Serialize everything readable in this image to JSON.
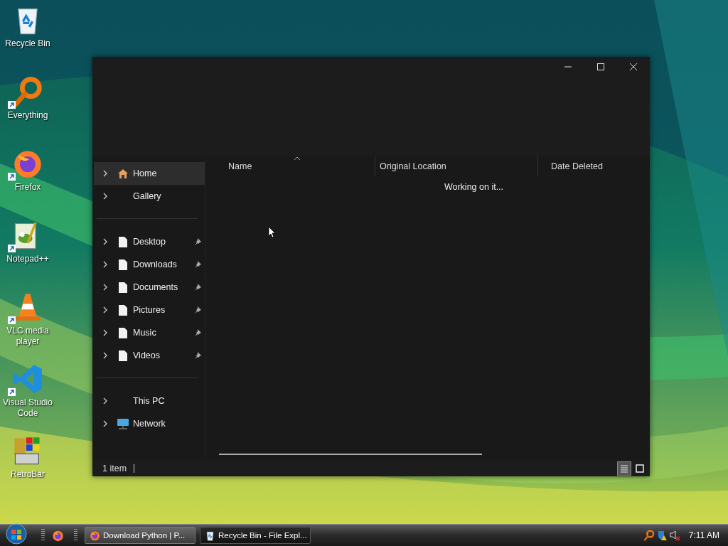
{
  "desktop_icons": [
    {
      "label": "Recycle Bin",
      "kind": "recycle",
      "shortcut": false
    },
    {
      "label": "Everything",
      "kind": "everything",
      "shortcut": true
    },
    {
      "label": "Firefox",
      "kind": "firefox",
      "shortcut": true
    },
    {
      "label": "Notepad++",
      "kind": "notepad",
      "shortcut": true
    },
    {
      "label": "VLC media player",
      "kind": "vlc",
      "shortcut": true
    },
    {
      "label": "Visual Studio Code",
      "kind": "vscode",
      "shortcut": true
    },
    {
      "label": "RetroBar",
      "kind": "retrobar",
      "shortcut": false
    }
  ],
  "window": {
    "sidebar": [
      [
        {
          "label": "Home",
          "kind": "home",
          "pinned": false,
          "selected": true
        },
        {
          "label": "Gallery",
          "kind": "none",
          "pinned": false,
          "selected": false
        }
      ],
      [
        {
          "label": "Desktop",
          "kind": "file",
          "pinned": true,
          "selected": false
        },
        {
          "label": "Downloads",
          "kind": "file",
          "pinned": true,
          "selected": false
        },
        {
          "label": "Documents",
          "kind": "file",
          "pinned": true,
          "selected": false
        },
        {
          "label": "Pictures",
          "kind": "file",
          "pinned": true,
          "selected": false
        },
        {
          "label": "Music",
          "kind": "file",
          "pinned": true,
          "selected": false
        },
        {
          "label": "Videos",
          "kind": "file",
          "pinned": true,
          "selected": false
        }
      ],
      [
        {
          "label": "This PC",
          "kind": "none",
          "pinned": false,
          "selected": false
        },
        {
          "label": "Network",
          "kind": "network",
          "pinned": false,
          "selected": false
        }
      ]
    ],
    "columns": [
      {
        "label": "Name",
        "sorted": true
      },
      {
        "label": "Original Location",
        "sorted": false
      },
      {
        "label": "Date Deleted",
        "sorted": false
      }
    ],
    "message": "Working on it...",
    "status": "1 item",
    "views": [
      {
        "kind": "details",
        "selected": true
      },
      {
        "kind": "tiles",
        "selected": false
      }
    ]
  },
  "taskbar": {
    "quick_launch": [
      {
        "kind": "firefox"
      }
    ],
    "tasks": [
      {
        "label": "Download Python | P...",
        "kind": "firefox",
        "selected": false
      },
      {
        "label": "Recycle Bin - File Expl...",
        "kind": "recycle",
        "selected": true
      }
    ],
    "tray": [
      {
        "kind": "everything"
      },
      {
        "kind": "shield"
      },
      {
        "kind": "speaker-muted"
      }
    ],
    "clock": "7:11 AM"
  }
}
